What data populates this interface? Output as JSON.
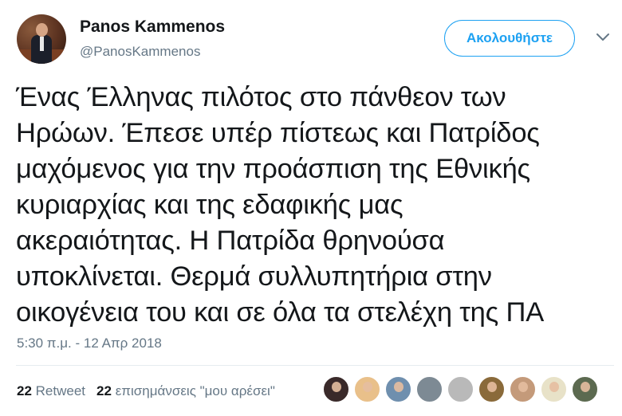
{
  "author": {
    "display_name": "Panos Kammenos",
    "handle": "@PanosKammenos"
  },
  "follow_label": "Ακολουθήστε",
  "tweet": {
    "lines": [
      "Ένας Έλληνας πιλότος στο πάνθεον των",
      "Ηρώων. Έπεσε υπέρ πίστεως και Πατρίδος",
      "μαχόμενος για την προάσπιση της Εθνικής",
      "κυριαρχίας και της εδαφικής μας",
      "ακεραιότητας. Η Πατρίδα θρηνούσα",
      "υποκλίνεται. Θερμά συλλυπητήρια στην",
      "οικογένεια του και σε όλα τα στελέχη της ΠΑ"
    ]
  },
  "timestamp": "5:30 π.μ. - 12 Απρ 2018",
  "stats": {
    "retweets_count": "22",
    "retweets_label": "Retweet",
    "likes_count": "22",
    "likes_label": "επισημάνσεις \"μου αρέσει\""
  },
  "colors": {
    "accent": "#1da1f2",
    "text": "#14171a",
    "muted": "#657786",
    "divider": "#e6ecf0"
  },
  "icons": {
    "menu": "chevron-down-icon"
  },
  "liker_avatars": [
    {
      "bg": "#3a2a2a"
    },
    {
      "bg": "#e9c08a"
    },
    {
      "bg": "#6f8fae"
    },
    {
      "bg": "#7d8a94"
    },
    {
      "bg": "#b9b9b9"
    },
    {
      "bg": "#8a6a3a"
    },
    {
      "bg": "#c49a7a"
    },
    {
      "bg": "#e8e2c8"
    },
    {
      "bg": "#5c6a50"
    }
  ]
}
